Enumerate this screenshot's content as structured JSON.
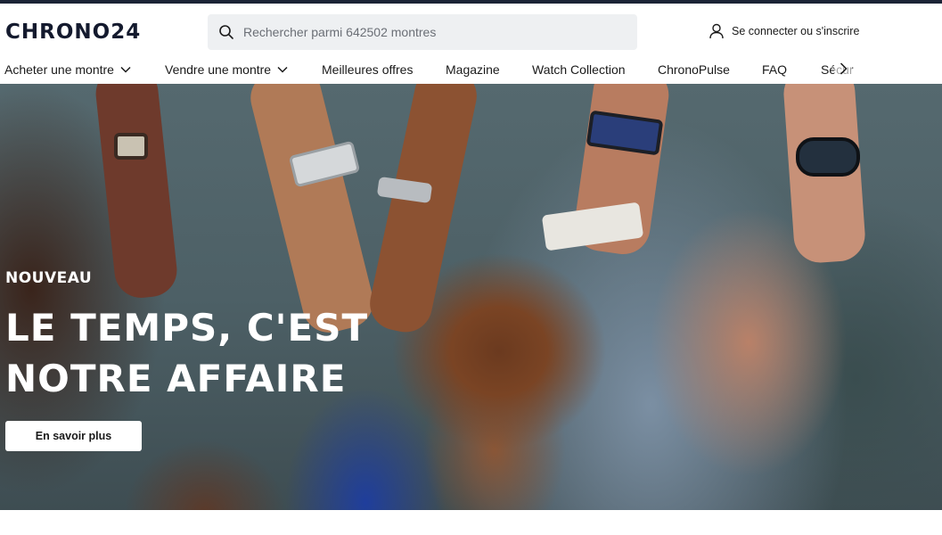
{
  "brand": {
    "logo_text": "CHRONO24"
  },
  "search": {
    "placeholder": "Rechercher parmi 642502 montres"
  },
  "account": {
    "label": "Se connecter ou s'inscrire"
  },
  "nav": {
    "items": [
      {
        "label": "Acheter une montre",
        "has_dropdown": true
      },
      {
        "label": "Vendre une montre",
        "has_dropdown": true
      },
      {
        "label": "Meilleures offres",
        "has_dropdown": false
      },
      {
        "label": "Magazine",
        "has_dropdown": false
      },
      {
        "label": "Watch Collection",
        "has_dropdown": false
      },
      {
        "label": "ChronoPulse",
        "has_dropdown": false
      },
      {
        "label": "FAQ",
        "has_dropdown": false
      },
      {
        "label": "Sécur",
        "has_dropdown": false
      }
    ]
  },
  "hero": {
    "kicker": "NOUVEAU",
    "title_line1": "LE TEMPS, C'EST",
    "title_line2": "NOTRE AFFAIRE",
    "cta_label": "En savoir plus"
  },
  "icons": {
    "search": "search-icon",
    "user": "user-icon",
    "chevron": "chevron-down-icon",
    "next": "chevron-right-icon"
  },
  "colors": {
    "topbar": "#1b2336",
    "logo": "#141a2e",
    "search_bg": "#eef0f2",
    "hero_text": "#ffffff",
    "cta_bg": "#ffffff"
  }
}
